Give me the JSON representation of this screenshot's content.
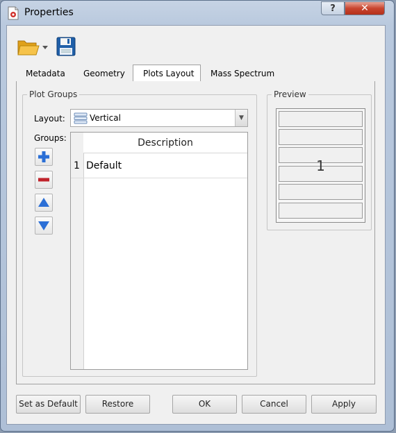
{
  "window": {
    "title": "Properties"
  },
  "toolbar": {
    "open_icon": "folder-open-icon",
    "save_icon": "floppy-save-icon"
  },
  "tabs": [
    {
      "label": "Metadata"
    },
    {
      "label": "Geometry"
    },
    {
      "label": "Plots Layout",
      "active": true
    },
    {
      "label": "Mass Spectrum"
    }
  ],
  "plot_groups": {
    "title": "Plot Groups",
    "layout_label": "Layout:",
    "layout_value": "Vertical",
    "groups_label": "Groups:",
    "table": {
      "column_header": "Description",
      "rows": [
        {
          "index": "1",
          "description": "Default"
        }
      ]
    }
  },
  "preview": {
    "title": "Preview",
    "number": "1"
  },
  "buttons": {
    "set_default": "Set as Default",
    "restore": "Restore",
    "ok": "OK",
    "cancel": "Cancel",
    "apply": "Apply"
  },
  "colors": {
    "accent_blue": "#2b6fd6",
    "remove_red": "#c0232b",
    "close_red": "#c8452f"
  }
}
